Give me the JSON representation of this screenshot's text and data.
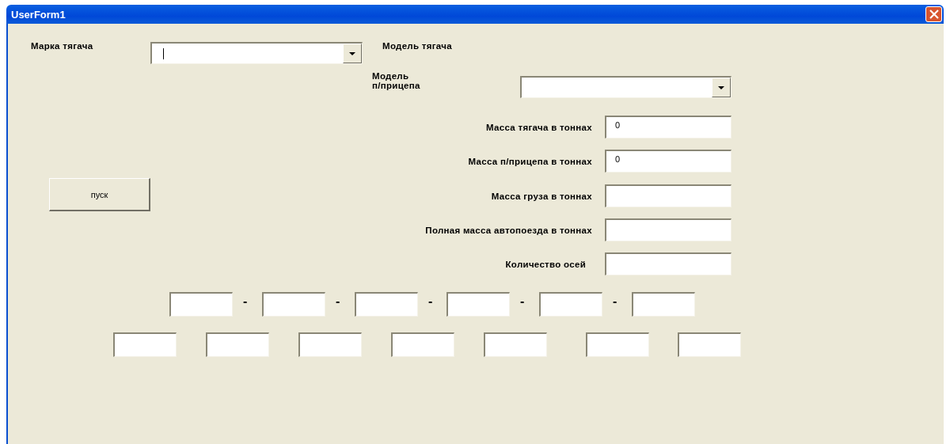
{
  "window": {
    "title": "UserForm1"
  },
  "selectors": [
    {
      "label": "Марка тягача",
      "focused": true
    },
    {
      "label": "Модель п/прицепа",
      "focused": false
    }
  ],
  "caption": "Модель тягача",
  "mass_fields": [
    {
      "label": "Масса тягача в тоннах",
      "value": "0"
    },
    {
      "label": "Масса п/прицепа в тоннах",
      "value": "0"
    },
    {
      "label": "Масса груза в тоннах"
    },
    {
      "label": "Полная масса автопоезда в тоннах"
    },
    {
      "label": "Количество осей"
    }
  ],
  "start_button": "пуск",
  "axle_row": {
    "separators": [
      "-",
      "-",
      "-",
      "-",
      "-"
    ]
  }
}
